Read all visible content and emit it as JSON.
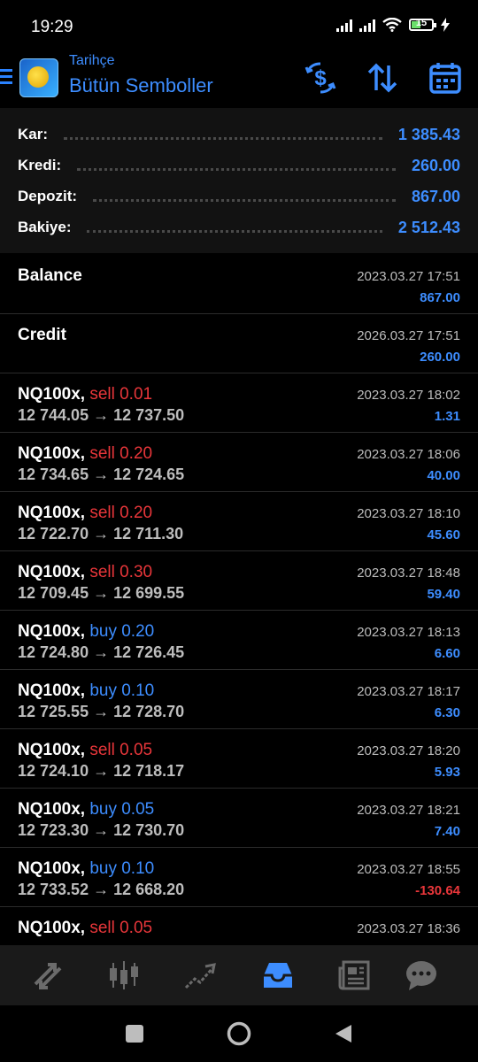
{
  "status": {
    "time": "19:29",
    "battery": "15"
  },
  "header": {
    "subtitle": "Tarihçe",
    "title": "Bütün Semboller"
  },
  "summary": [
    {
      "label": "Kar:",
      "value": "1 385.43"
    },
    {
      "label": "Kredi:",
      "value": "260.00"
    },
    {
      "label": "Depozit:",
      "value": "867.00"
    },
    {
      "label": "Bakiye:",
      "value": "2 512.43"
    }
  ],
  "entries": [
    {
      "title": "Balance",
      "time": "2023.03.27 17:51",
      "amount": "867.00"
    },
    {
      "title": "Credit",
      "time": "2026.03.27 17:51",
      "amount": "260.00"
    }
  ],
  "deals": [
    {
      "symbol": "NQ100x,",
      "side": "sell",
      "volume": "sell 0.01",
      "prices": "12 744.05 → 12 737.50",
      "time": "2023.03.27 18:02",
      "profit": "1.31",
      "negative": false
    },
    {
      "symbol": "NQ100x,",
      "side": "sell",
      "volume": "sell 0.20",
      "prices": "12 734.65 → 12 724.65",
      "time": "2023.03.27 18:06",
      "profit": "40.00",
      "negative": false
    },
    {
      "symbol": "NQ100x,",
      "side": "sell",
      "volume": "sell 0.20",
      "prices": "12 722.70 → 12 711.30",
      "time": "2023.03.27 18:10",
      "profit": "45.60",
      "negative": false
    },
    {
      "symbol": "NQ100x,",
      "side": "sell",
      "volume": "sell 0.30",
      "prices": "12 709.45 → 12 699.55",
      "time": "2023.03.27 18:48",
      "profit": "59.40",
      "negative": false
    },
    {
      "symbol": "NQ100x,",
      "side": "buy",
      "volume": "buy 0.20",
      "prices": "12 724.80 → 12 726.45",
      "time": "2023.03.27 18:13",
      "profit": "6.60",
      "negative": false
    },
    {
      "symbol": "NQ100x,",
      "side": "buy",
      "volume": "buy 0.10",
      "prices": "12 725.55 → 12 728.70",
      "time": "2023.03.27 18:17",
      "profit": "6.30",
      "negative": false
    },
    {
      "symbol": "NQ100x,",
      "side": "sell",
      "volume": "sell 0.05",
      "prices": "12 724.10 → 12 718.17",
      "time": "2023.03.27 18:20",
      "profit": "5.93",
      "negative": false
    },
    {
      "symbol": "NQ100x,",
      "side": "buy",
      "volume": "buy 0.05",
      "prices": "12 723.30 → 12 730.70",
      "time": "2023.03.27 18:21",
      "profit": "7.40",
      "negative": false
    },
    {
      "symbol": "NQ100x,",
      "side": "buy",
      "volume": "buy 0.10",
      "prices": "12 733.52 → 12 668.20",
      "time": "2023.03.27 18:55",
      "profit": "-130.64",
      "negative": true
    },
    {
      "symbol": "NQ100x,",
      "side": "sell",
      "volume": "sell 0.05",
      "prices": "",
      "time": "2023.03.27 18:36",
      "profit": "",
      "negative": false
    }
  ],
  "colors": {
    "accent": "#3d8dff",
    "sell": "#e8363a",
    "buy": "#3d8dff",
    "muted": "#bdbdbd"
  },
  "tabs": [
    {
      "icon": "quotes-icon",
      "active": false
    },
    {
      "icon": "chart-candles-icon",
      "active": false
    },
    {
      "icon": "trade-icon",
      "active": false
    },
    {
      "icon": "history-icon",
      "active": true
    },
    {
      "icon": "news-icon",
      "active": false
    },
    {
      "icon": "chat-icon",
      "active": false
    }
  ]
}
